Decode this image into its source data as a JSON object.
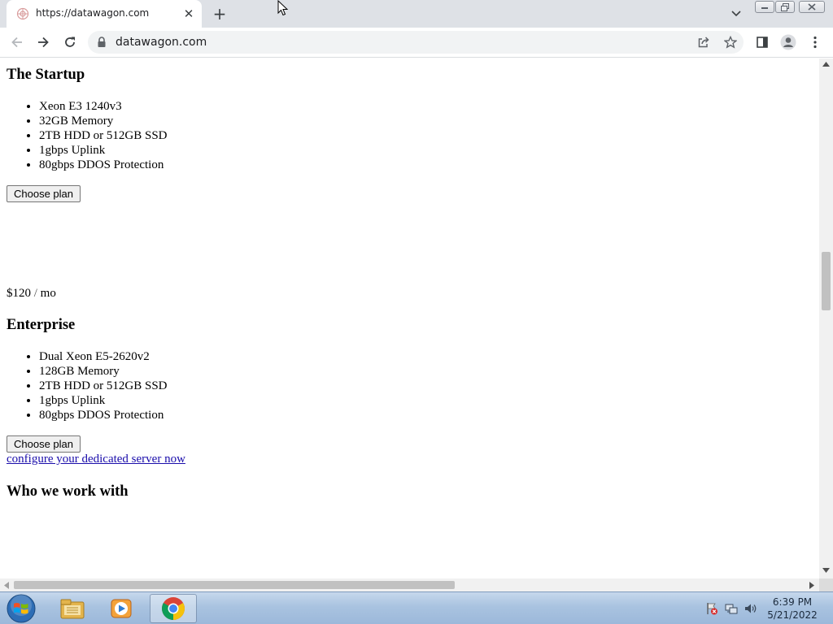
{
  "browser": {
    "tab_title": "https://datawagon.com",
    "url": "datawagon.com",
    "new_tab_symbol": "+",
    "close_tab_symbol": "✕"
  },
  "page": {
    "startup": {
      "heading": "The Startup",
      "features": [
        "Xeon E3 1240v3",
        "32GB Memory",
        "2TB HDD or 512GB SSD",
        "1gbps Uplink",
        "80gbps DDOS Protection"
      ],
      "button_label": "Choose plan"
    },
    "enterprise": {
      "price_amount": "$120",
      "price_sep": "/",
      "price_period": "mo",
      "heading": "Enterprise",
      "features": [
        "Dual Xeon E5-2620v2",
        "128GB Memory",
        "2TB HDD or 512GB SSD",
        "1gbps Uplink",
        "80gbps DDOS Protection"
      ],
      "button_label": "Choose plan",
      "configure_link": "configure your dedicated server now"
    },
    "partners_heading": "Who we work with"
  },
  "taskbar": {
    "time": "6:39 PM",
    "date": "5/21/2022"
  },
  "icons": [
    "favicon-icon",
    "close-icon",
    "plus-icon",
    "chevron-down-icon",
    "back-icon",
    "forward-icon",
    "reload-icon",
    "lock-icon",
    "share-icon",
    "star-icon",
    "side-panel-icon",
    "profile-icon",
    "menu-icon",
    "windows-start-icon",
    "file-explorer-icon",
    "media-player-icon",
    "chrome-icon",
    "flag-icon",
    "network-icon",
    "volume-icon"
  ]
}
